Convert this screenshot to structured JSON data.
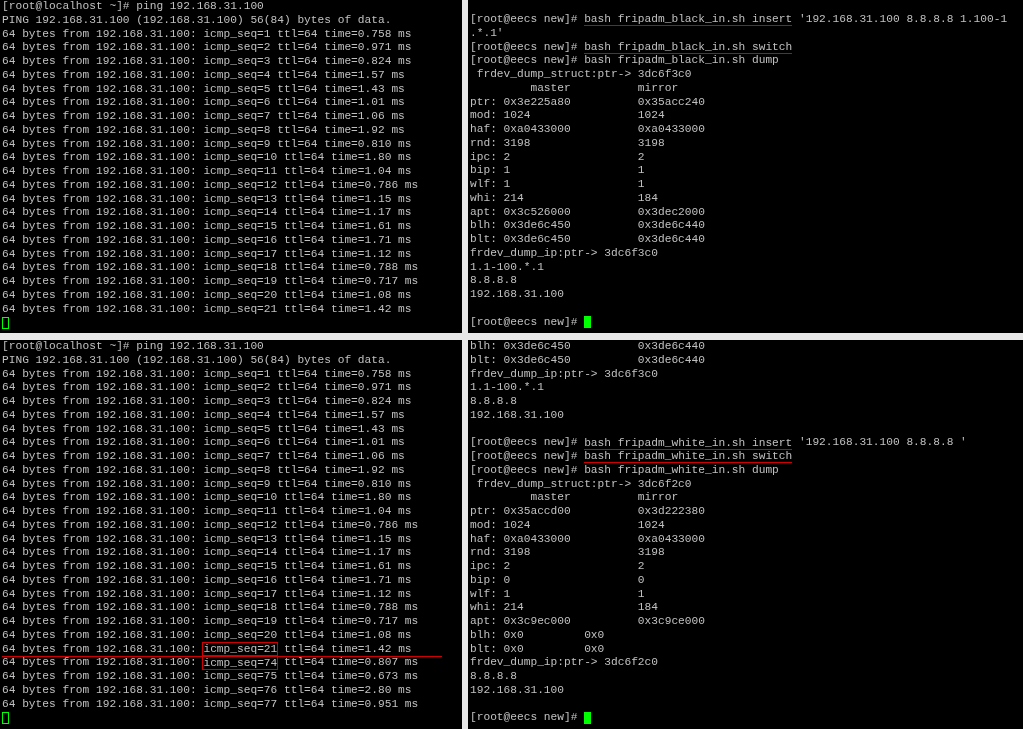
{
  "panes": [
    {
      "lines": [
        {
          "text": "[root@localhost ~]# ping 192.168.31.100"
        },
        {
          "text": "PING 192.168.31.100 (192.168.31.100) 56(84) bytes of data."
        },
        {
          "text": "64 bytes from 192.168.31.100: icmp_seq=1 ttl=64 time=0.758 ms"
        },
        {
          "text": "64 bytes from 192.168.31.100: icmp_seq=2 ttl=64 time=0.971 ms"
        },
        {
          "text": "64 bytes from 192.168.31.100: icmp_seq=3 ttl=64 time=0.824 ms"
        },
        {
          "text": "64 bytes from 192.168.31.100: icmp_seq=4 ttl=64 time=1.57 ms"
        },
        {
          "text": "64 bytes from 192.168.31.100: icmp_seq=5 ttl=64 time=1.43 ms"
        },
        {
          "text": "64 bytes from 192.168.31.100: icmp_seq=6 ttl=64 time=1.01 ms"
        },
        {
          "text": "64 bytes from 192.168.31.100: icmp_seq=7 ttl=64 time=1.06 ms"
        },
        {
          "text": "64 bytes from 192.168.31.100: icmp_seq=8 ttl=64 time=1.92 ms"
        },
        {
          "text": "64 bytes from 192.168.31.100: icmp_seq=9 ttl=64 time=0.810 ms"
        },
        {
          "text": "64 bytes from 192.168.31.100: icmp_seq=10 ttl=64 time=1.80 ms"
        },
        {
          "text": "64 bytes from 192.168.31.100: icmp_seq=11 ttl=64 time=1.04 ms"
        },
        {
          "text": "64 bytes from 192.168.31.100: icmp_seq=12 ttl=64 time=0.786 ms"
        },
        {
          "text": "64 bytes from 192.168.31.100: icmp_seq=13 ttl=64 time=1.15 ms"
        },
        {
          "text": "64 bytes from 192.168.31.100: icmp_seq=14 ttl=64 time=1.17 ms"
        },
        {
          "text": "64 bytes from 192.168.31.100: icmp_seq=15 ttl=64 time=1.61 ms"
        },
        {
          "text": "64 bytes from 192.168.31.100: icmp_seq=16 ttl=64 time=1.71 ms"
        },
        {
          "text": "64 bytes from 192.168.31.100: icmp_seq=17 ttl=64 time=1.12 ms"
        },
        {
          "text": "64 bytes from 192.168.31.100: icmp_seq=18 ttl=64 time=0.788 ms"
        },
        {
          "text": "64 bytes from 192.168.31.100: icmp_seq=19 ttl=64 time=0.717 ms"
        },
        {
          "text": "64 bytes from 192.168.31.100: icmp_seq=20 ttl=64 time=1.08 ms"
        },
        {
          "text": "64 bytes from 192.168.31.100: icmp_seq=21 ttl=64 time=1.42 ms"
        },
        {
          "cursor": {
            "filled": false
          }
        }
      ]
    },
    {
      "lines": [
        {
          "segments": [
            {
              "text": "[root@eecs new]# "
            },
            {
              "text": "bash fripadm_black_in.sh insert",
              "underlined": true
            },
            {
              "text": " '192.168.31.100 8.8.8.8 1.100-1"
            }
          ]
        },
        {
          "text": ".*.1'"
        },
        {
          "segments": [
            {
              "text": "[root@eecs new]# "
            },
            {
              "text": "bash fripadm_black_in.sh switch",
              "underlined": true
            }
          ]
        },
        {
          "text": "[root@eecs new]# bash fripadm_black_in.sh dump"
        },
        {
          "text": " frdev_dump_struct:ptr-> 3dc6f3c0"
        },
        {
          "text": "         master          mirror"
        },
        {
          "text": "ptr: 0x3e225a80          0x35acc240"
        },
        {
          "text": "mod: 1024                1024"
        },
        {
          "text": "haf: 0xa0433000          0xa0433000"
        },
        {
          "text": "rnd: 3198                3198"
        },
        {
          "text": "ipc: 2                   2"
        },
        {
          "text": "bip: 1                   1"
        },
        {
          "text": "wlf: 1                   1"
        },
        {
          "text": "whi: 214                 184"
        },
        {
          "text": "apt: 0x3c526000          0x3dec2000"
        },
        {
          "text": "blh: 0x3de6c450          0x3de6c440"
        },
        {
          "text": "blt: 0x3de6c450          0x3de6c440"
        },
        {
          "text": "frdev_dump_ip:ptr-> 3dc6f3c0"
        },
        {
          "text": "1.1-100.*.1"
        },
        {
          "text": "8.8.8.8"
        },
        {
          "text": "192.168.31.100"
        },
        {
          "text": "[root@eecs new]# ",
          "gap_above": true,
          "cursor": {
            "filled": true
          }
        }
      ]
    },
    {
      "lines": [
        {
          "text": "[root@localhost ~]# ping 192.168.31.100"
        },
        {
          "text": "PING 192.168.31.100 (192.168.31.100) 56(84) bytes of data."
        },
        {
          "text": "64 bytes from 192.168.31.100: icmp_seq=1 ttl=64 time=0.758 ms"
        },
        {
          "text": "64 bytes from 192.168.31.100: icmp_seq=2 ttl=64 time=0.971 ms"
        },
        {
          "text": "64 bytes from 192.168.31.100: icmp_seq=3 ttl=64 time=0.824 ms"
        },
        {
          "text": "64 bytes from 192.168.31.100: icmp_seq=4 ttl=64 time=1.57 ms"
        },
        {
          "text": "64 bytes from 192.168.31.100: icmp_seq=5 ttl=64 time=1.43 ms"
        },
        {
          "text": "64 bytes from 192.168.31.100: icmp_seq=6 ttl=64 time=1.01 ms"
        },
        {
          "text": "64 bytes from 192.168.31.100: icmp_seq=7 ttl=64 time=1.06 ms"
        },
        {
          "text": "64 bytes from 192.168.31.100: icmp_seq=8 ttl=64 time=1.92 ms"
        },
        {
          "text": "64 bytes from 192.168.31.100: icmp_seq=9 ttl=64 time=0.810 ms"
        },
        {
          "text": "64 bytes from 192.168.31.100: icmp_seq=10 ttl=64 time=1.80 ms"
        },
        {
          "text": "64 bytes from 192.168.31.100: icmp_seq=11 ttl=64 time=1.04 ms"
        },
        {
          "text": "64 bytes from 192.168.31.100: icmp_seq=12 ttl=64 time=0.786 ms"
        },
        {
          "text": "64 bytes from 192.168.31.100: icmp_seq=13 ttl=64 time=1.15 ms"
        },
        {
          "text": "64 bytes from 192.168.31.100: icmp_seq=14 ttl=64 time=1.17 ms"
        },
        {
          "text": "64 bytes from 192.168.31.100: icmp_seq=15 ttl=64 time=1.61 ms"
        },
        {
          "text": "64 bytes from 192.168.31.100: icmp_seq=16 ttl=64 time=1.71 ms"
        },
        {
          "text": "64 bytes from 192.168.31.100: icmp_seq=17 ttl=64 time=1.12 ms"
        },
        {
          "text": "64 bytes from 192.168.31.100: icmp_seq=18 ttl=64 time=0.788 ms"
        },
        {
          "text": "64 bytes from 192.168.31.100: icmp_seq=19 ttl=64 time=0.717 ms"
        },
        {
          "text": "64 bytes from 192.168.31.100: icmp_seq=20 ttl=64 time=1.08 ms"
        },
        {
          "segments": [
            {
              "text": "64 bytes from 192.168.31.100: "
            },
            {
              "text": "icmp_seq=21",
              "boxed": true
            },
            {
              "text": " ttl=64 time=1.42 ms"
            }
          ],
          "rule_below": true
        },
        {
          "segments": [
            {
              "text": "64 bytes from 192.168.31.100: "
            },
            {
              "text": "icmp_seq=74",
              "boxed": true
            },
            {
              "text": " ttl=64 time=0.807 ms"
            }
          ]
        },
        {
          "text": "64 bytes from 192.168.31.100: icmp_seq=75 ttl=64 time=0.673 ms"
        },
        {
          "text": "64 bytes from 192.168.31.100: icmp_seq=76 ttl=64 time=2.80 ms"
        },
        {
          "text": "64 bytes from 192.168.31.100: icmp_seq=77 ttl=64 time=0.951 ms"
        },
        {
          "cursor": {
            "filled": false
          }
        }
      ]
    },
    {
      "lines": [
        {
          "text": "blh: 0x3de6c450          0x3de6c440"
        },
        {
          "text": "blt: 0x3de6c450          0x3de6c440"
        },
        {
          "text": "frdev_dump_ip:ptr-> 3dc6f3c0"
        },
        {
          "text": "1.1-100.*.1"
        },
        {
          "text": "8.8.8.8"
        },
        {
          "text": "192.168.31.100"
        },
        {
          "gap_above": true,
          "segments": [
            {
              "text": "[root@eecs new]# "
            },
            {
              "text": "bash fripadm_white_in.sh insert",
              "underlined": true
            },
            {
              "text": " '192.168.31.100 8.8.8.8 '"
            }
          ]
        },
        {
          "segments": [
            {
              "text": "[root@eecs new]# "
            },
            {
              "text": "bash fripadm_white_in.sh switch",
              "underlined": true
            }
          ]
        },
        {
          "text": "[root@eecs new]# bash fripadm_white_in.sh dump"
        },
        {
          "text": " frdev_dump_struct:ptr-> 3dc6f2c0"
        },
        {
          "text": "         master          mirror"
        },
        {
          "text": "ptr: 0x35accd00          0x3d222380"
        },
        {
          "text": "mod: 1024                1024"
        },
        {
          "text": "haf: 0xa0433000          0xa0433000"
        },
        {
          "text": "rnd: 3198                3198"
        },
        {
          "text": "ipc: 2                   2"
        },
        {
          "text": "bip: 0                   0"
        },
        {
          "text": "wlf: 1                   1"
        },
        {
          "text": "whi: 214                 184"
        },
        {
          "text": "apt: 0x3c9ec000          0x3c9ce000"
        },
        {
          "text": "blh: 0x0         0x0"
        },
        {
          "text": "blt: 0x0         0x0"
        },
        {
          "text": "frdev_dump_ip:ptr-> 3dc6f2c0"
        },
        {
          "text": "8.8.8.8"
        },
        {
          "text": "192.168.31.100"
        },
        {
          "text": "[root@eecs new]# ",
          "gap_above": true,
          "cursor": {
            "filled": true
          }
        }
      ]
    }
  ]
}
